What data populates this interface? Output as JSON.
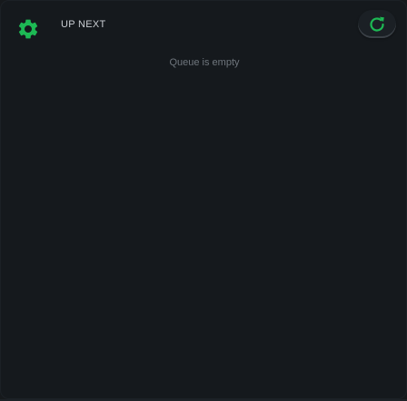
{
  "header": {
    "title": "UP NEXT",
    "settings_icon": "gear-icon",
    "refresh_icon": "refresh-icon"
  },
  "queue": {
    "empty_message": "Queue is empty"
  },
  "colors": {
    "accent": "#1db954",
    "background": "#15191d",
    "text_primary": "#c9cdd2",
    "text_muted": "#6f767d"
  }
}
